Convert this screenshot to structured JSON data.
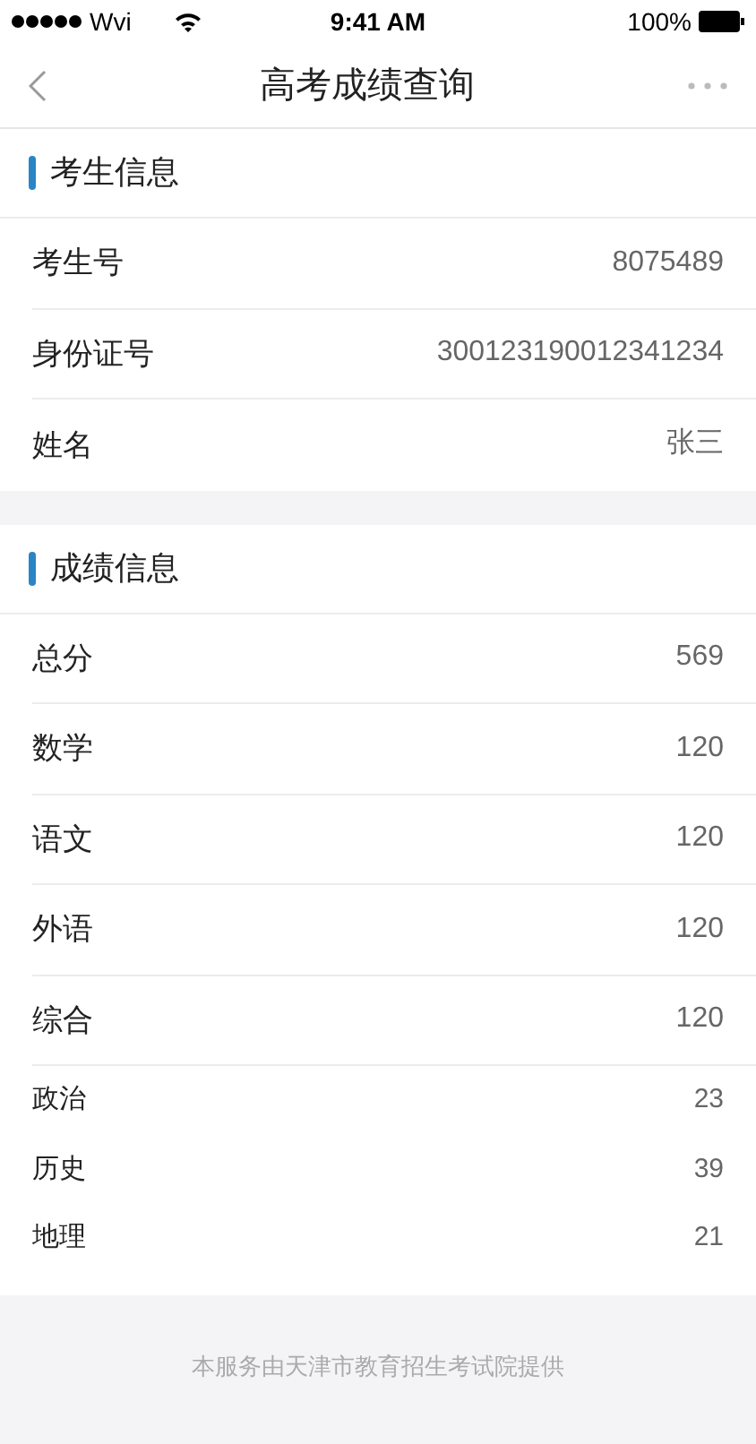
{
  "status_bar": {
    "carrier": "Wvi",
    "time": "9:41 AM",
    "battery": "100%"
  },
  "nav_bar": {
    "title": "高考成绩查询"
  },
  "sections": [
    {
      "title": "考生信息",
      "rows": [
        {
          "kind": "main",
          "label": "考生号",
          "value": "8075489"
        },
        {
          "kind": "main",
          "label": "身份证号",
          "value": "300123190012341234"
        },
        {
          "kind": "main",
          "label": "姓名",
          "value": "张三"
        }
      ]
    },
    {
      "title": "成绩信息",
      "rows": [
        {
          "kind": "main",
          "label": "总分",
          "value": "569"
        },
        {
          "kind": "main",
          "label": "数学",
          "value": "120"
        },
        {
          "kind": "main",
          "label": "语文",
          "value": "120"
        },
        {
          "kind": "main",
          "label": "外语",
          "value": "120"
        },
        {
          "kind": "main",
          "label": "综合",
          "value": "120"
        },
        {
          "kind": "sub",
          "label": "政治",
          "value": "23"
        },
        {
          "kind": "sub",
          "label": "历史",
          "value": "39"
        },
        {
          "kind": "sub",
          "label": "地理",
          "value": "21"
        }
      ]
    }
  ],
  "footer": "本服务由天津市教育招生考试院提供"
}
